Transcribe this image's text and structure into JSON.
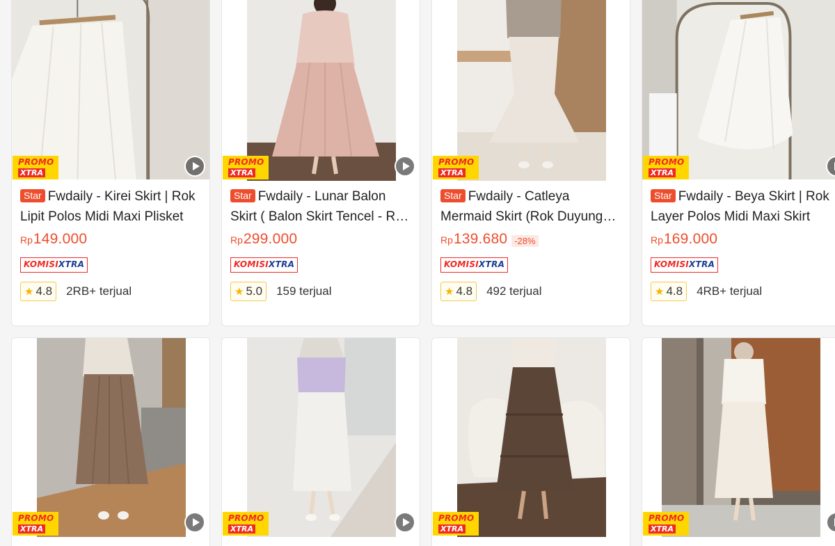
{
  "badges": {
    "promo_line1": "PROMO",
    "promo_line2": "XTRA",
    "star": "Star",
    "komisi_part1": "KOMISI",
    "komisi_part2": "XTRA"
  },
  "icons": {
    "play": "play-circle-icon",
    "rating_star": "star-icon",
    "rating_star_glyph": "★"
  },
  "colors": {
    "accent": "#ee4d2d",
    "promo_yellow": "#ffd600",
    "promo_red": "#ee2a24",
    "komisi_blue": "#1c3f94",
    "rating_border": "#f2c94c"
  },
  "products": [
    {
      "title": "Fwdaily - Kirei Skirt | Rok Lipit Polos Midi Maxi Plisket",
      "currency": "Rp",
      "price": "149.000",
      "discount": "",
      "rating": "4.8",
      "sold": "2RB+ terjual",
      "image": "white pleated skirt on hanger"
    },
    {
      "title": "Fwdaily - Lunar Balon Skirt ( Balon Skirt Tencel - Rok Balon )",
      "currency": "Rp",
      "price": "299.000",
      "discount": "",
      "rating": "5.0",
      "sold": "159 terjual",
      "image": "pink balloon skirt outfit"
    },
    {
      "title": "Fwdaily - Catleya Mermaid Skirt (Rok Duyung Polos)",
      "currency": "Rp",
      "price": "139.680",
      "discount": "-28%",
      "rating": "4.8",
      "sold": "492 terjual",
      "image": "cream mermaid skirt outfit"
    },
    {
      "title": "Fwdaily - Beya Skirt | Rok Layer Polos Midi Maxi Skirt",
      "currency": "Rp",
      "price": "169.000",
      "discount": "",
      "rating": "4.8",
      "sold": "4RB+ terjual",
      "image": "white layered skirt on hanger"
    },
    {
      "image": "taupe pleated skirt outfit"
    },
    {
      "image": "white satin skirt outfit"
    },
    {
      "image": "brown tiered skirt outfit"
    },
    {
      "image": "white textured skirt outfit"
    }
  ]
}
